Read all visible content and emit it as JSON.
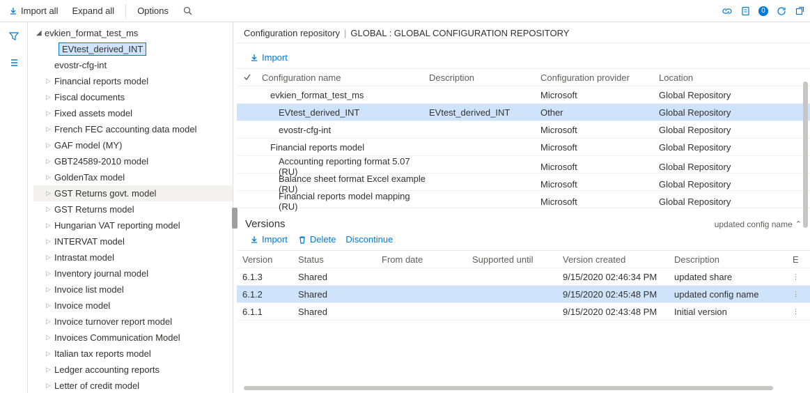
{
  "toolbar": {
    "import_all": "Import all",
    "expand_all": "Expand all",
    "options": "Options",
    "badge": "0"
  },
  "tree": {
    "root": "evkien_format_test_ms",
    "selected": "EVtest_derived_INT",
    "items": [
      "evostr-cfg-int",
      "Financial reports model",
      "Fiscal documents",
      "Fixed assets model",
      "French FEC accounting data model",
      "GAF model (MY)",
      "GBT24589-2010 model",
      "GoldenTax model",
      "GST Returns govt. model",
      "GST Returns model",
      "Hungarian VAT reporting model",
      "INTERVAT model",
      "Intrastat model",
      "Inventory journal model",
      "Invoice list model",
      "Invoice model",
      "Invoice turnover report model",
      "Invoices Communication Model",
      "Italian tax reports model",
      "Ledger accounting reports",
      "Letter of credit model"
    ],
    "hover_index": 8
  },
  "crumb": {
    "a": "Configuration repository",
    "b": "GLOBAL : GLOBAL CONFIGURATION REPOSITORY"
  },
  "configs": {
    "import_label": "Import",
    "head": {
      "name": "Configuration name",
      "desc": "Description",
      "provider": "Configuration provider",
      "location": "Location"
    },
    "rows": [
      {
        "name": "evkien_format_test_ms",
        "desc": "",
        "provider": "Microsoft",
        "location": "Global Repository",
        "indent": 1
      },
      {
        "name": "EVtest_derived_INT",
        "desc": "EVtest_derived_INT",
        "provider": "Other",
        "location": "Global Repository",
        "indent": 2,
        "sel": true
      },
      {
        "name": "evostr-cfg-int",
        "desc": "",
        "provider": "Microsoft",
        "location": "Global Repository",
        "indent": 2
      },
      {
        "name": "Financial reports model",
        "desc": "",
        "provider": "Microsoft",
        "location": "Global Repository",
        "indent": 1
      },
      {
        "name": "Accounting reporting format 5.07 (RU)",
        "desc": "",
        "provider": "Microsoft",
        "location": "Global Repository",
        "indent": 2
      },
      {
        "name": "Balance sheet format Excel example (RU)",
        "desc": "",
        "provider": "Microsoft",
        "location": "Global Repository",
        "indent": 2
      },
      {
        "name": "Financial reports model mapping (RU)",
        "desc": "",
        "provider": "Microsoft",
        "location": "Global Repository",
        "indent": 2
      }
    ]
  },
  "versions": {
    "title": "Versions",
    "subtitle": "updated config name",
    "import": "Import",
    "delete": "Delete",
    "discontinue": "Discontinue",
    "head": {
      "version": "Version",
      "status": "Status",
      "from": "From date",
      "supported": "Supported until",
      "created": "Version created",
      "desc": "Description",
      "extra": "E"
    },
    "rows": [
      {
        "version": "6.1.3",
        "status": "Shared",
        "from": "",
        "supported": "",
        "created": "9/15/2020 02:46:34 PM",
        "desc": "updated share"
      },
      {
        "version": "6.1.2",
        "status": "Shared",
        "from": "",
        "supported": "",
        "created": "9/15/2020 02:45:48 PM",
        "desc": "updated config name",
        "sel": true
      },
      {
        "version": "6.1.1",
        "status": "Shared",
        "from": "",
        "supported": "",
        "created": "9/15/2020 02:43:48 PM",
        "desc": "Initial version"
      }
    ]
  }
}
